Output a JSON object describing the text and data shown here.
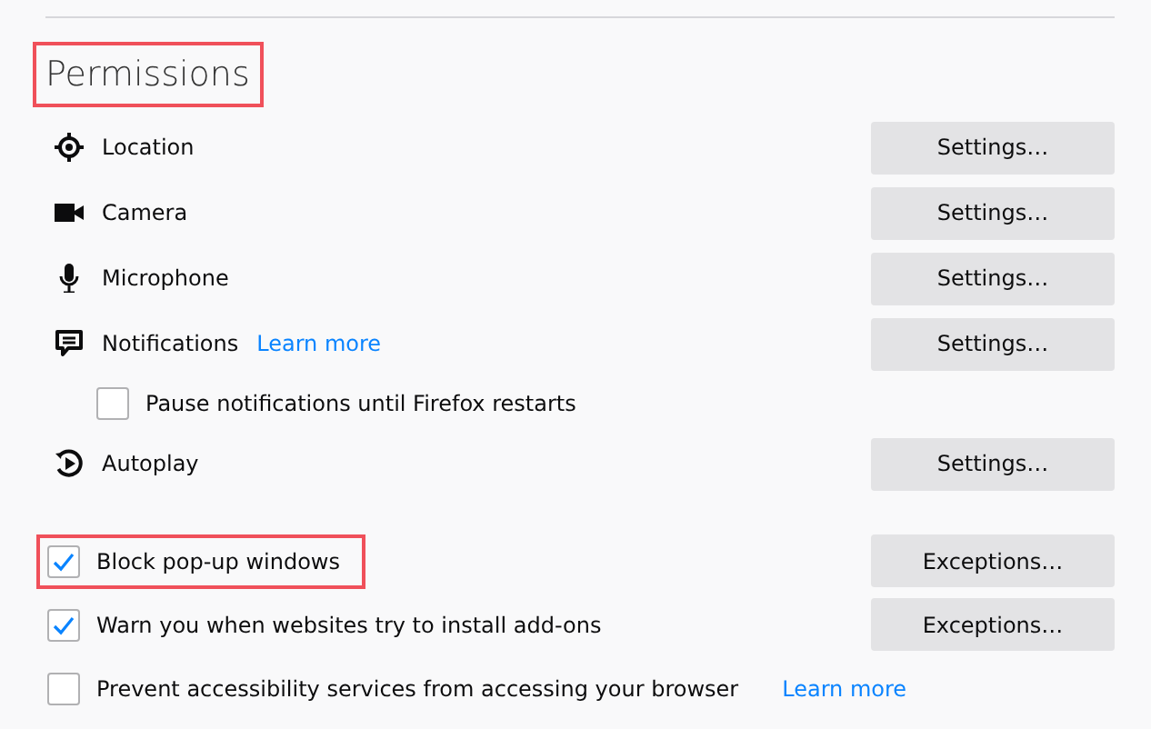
{
  "heading": {
    "text": "Permissions",
    "highlighted": true
  },
  "permissions": [
    {
      "kind": "location",
      "label": "Location",
      "button": "Settings…"
    },
    {
      "kind": "camera",
      "label": "Camera",
      "button": "Settings…"
    },
    {
      "kind": "microphone",
      "label": "Microphone",
      "button": "Settings…"
    },
    {
      "kind": "notifications",
      "label": "Notifications",
      "link": "Learn more",
      "button": "Settings…"
    },
    {
      "kind": "sub-checkbox",
      "label": "Pause notifications until Firefox restarts",
      "checked": false
    },
    {
      "kind": "autoplay",
      "label": "Autoplay",
      "button": "Settings…"
    }
  ],
  "options": [
    {
      "label": "Block pop-up windows",
      "checked": true,
      "highlighted": true,
      "button": "Exceptions…"
    },
    {
      "label": "Warn you when websites try to install add-ons",
      "checked": true,
      "highlighted": false,
      "button": "Exceptions…"
    },
    {
      "label": "Prevent accessibility services from accessing your browser",
      "checked": false,
      "highlighted": false,
      "link": "Learn more"
    }
  ]
}
